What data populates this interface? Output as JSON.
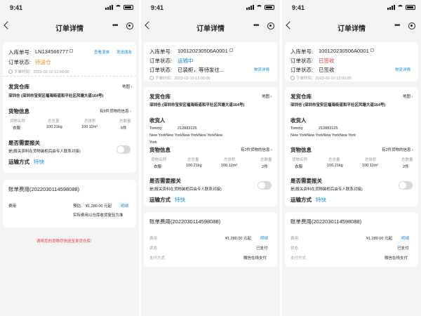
{
  "status_bar": {
    "time": "9:41"
  },
  "nav_title": "订单详情",
  "screen1": {
    "inbound_label": "入库单号:",
    "inbound_no": "LN134566777",
    "link_view_bill": "查看清单",
    "link_send_friend": "发送朋友",
    "status_label": "订单状态:",
    "status_value": "待送仓",
    "order_time": "下单时间：2023-02-10 12:00:00",
    "warehouse_title": "发货仓库",
    "map_label": "地图",
    "warehouse_addr": "深圳仓 (深圳市宝安区福海街道和平社区风塘大道164号)",
    "goods_title": "货物信息",
    "goods_link": "有5件货物的信息",
    "goods_headers": [
      "货物名称",
      "总总量",
      "总体积",
      "总数量"
    ],
    "goods_values": [
      "衣服",
      "100.21kg",
      "100.12m³",
      "5件"
    ],
    "customs_title": "是否需要报关",
    "customs_note": "是(报关资料在货物装柜后由专人联系对接)",
    "ship_label": "运输方式",
    "ship_value": "特快",
    "bill_title": "账单费用(2022030114598088)",
    "fee_label": "费用",
    "fee_estimate": "预估:",
    "fee_amount": "¥1,280.00 元起",
    "fee_detail": "明细",
    "fee_note": "实际费用以仓库收货复验为准",
    "warning": "请将您的货物尽快送至发货仓库!"
  },
  "screen2": {
    "inbound_label": "入库单号:",
    "inbound_no": "100120230506A0001",
    "status_label": "订单状态:",
    "status_value": "运输中",
    "status_label2": "订单状态:",
    "status_value2": "已装柜，等待发往...",
    "logistics_link": "物流详情",
    "order_time": "下单时间：2023-02-10 12:00:00",
    "warehouse_title": "发货仓库",
    "map_label": "地图",
    "warehouse_addr": "深圳仓 (深圳市宝安区福海街道和平社区风塘大道164号)",
    "recipient_title": "收货人",
    "recipient_name": "Tommy",
    "recipient_phone": "212883125",
    "recipient_addr1": "New YorkNew  YorkNew  YorkNew  YorkNew",
    "recipient_addr2": "York",
    "goods_title": "货物信息",
    "goods_link": "有2件货物的信息",
    "goods_headers": [
      "货物名称",
      "总总量",
      "总体积",
      "总数量"
    ],
    "goods_values": [
      "衣服",
      "100.21kg",
      "100.12m³",
      "2件"
    ],
    "customs_title": "是否需要报关",
    "customs_note": "是(报关资料在货物装柜后由专人联系对接)",
    "ship_label": "运输方式",
    "ship_value": "特快",
    "bill_title": "账单费用(2022030114598088)",
    "fee_label": "费用",
    "fee_amount": "¥1,280.00 元起",
    "fee_detail": "明细",
    "state_label": "状态",
    "state_value": "已支付",
    "pay_label": "支付方式",
    "pay_value": "微信在线支付"
  },
  "screen3": {
    "inbound_label": "入库单号:",
    "inbound_no": "100120230506A0001",
    "status_label": "订单状态:",
    "status_value": "已签收",
    "status_label2": "订单状态:",
    "status_value2": "已签收",
    "logistics_link": "物流详情",
    "order_time": "下单时间：2023-02-10 12:00:00",
    "warehouse_title": "发货仓库",
    "map_label": "地图",
    "warehouse_addr": "深圳仓 (深圳市宝安区福海街道和平社区风塘大道164号)",
    "recipient_title": "收货人",
    "recipient_name": "Tommy",
    "recipient_phone": "212883125",
    "recipient_addr1": "New YorkNew  YorkNew  YorkNew  York",
    "goods_title": "货物信息",
    "goods_link": "有2件货物的信息",
    "goods_headers": [
      "货物名称",
      "总总量",
      "总体积",
      "总数量"
    ],
    "goods_values": [
      "衣服",
      "100.21kg",
      "100.12m³",
      "2件"
    ],
    "customs_title": "是否需要报关",
    "customs_note": "是(报关资料在货物装柜后由专人联系对接)",
    "ship_label": "运输方式",
    "ship_value": "特快",
    "bill_title": "账单费用(2022030114598088)",
    "fee_label": "费用",
    "fee_amount": "¥1,280.00 元起",
    "fee_detail": "明细",
    "state_label": "状态",
    "state_value": "已支付",
    "pay_label": "支付方式",
    "pay_value": "微信在线支付"
  },
  "colors": {
    "accent": "#1a8bd8",
    "pending": "#f08b1e",
    "alert": "#e53935",
    "background": "#f3f3f5"
  }
}
